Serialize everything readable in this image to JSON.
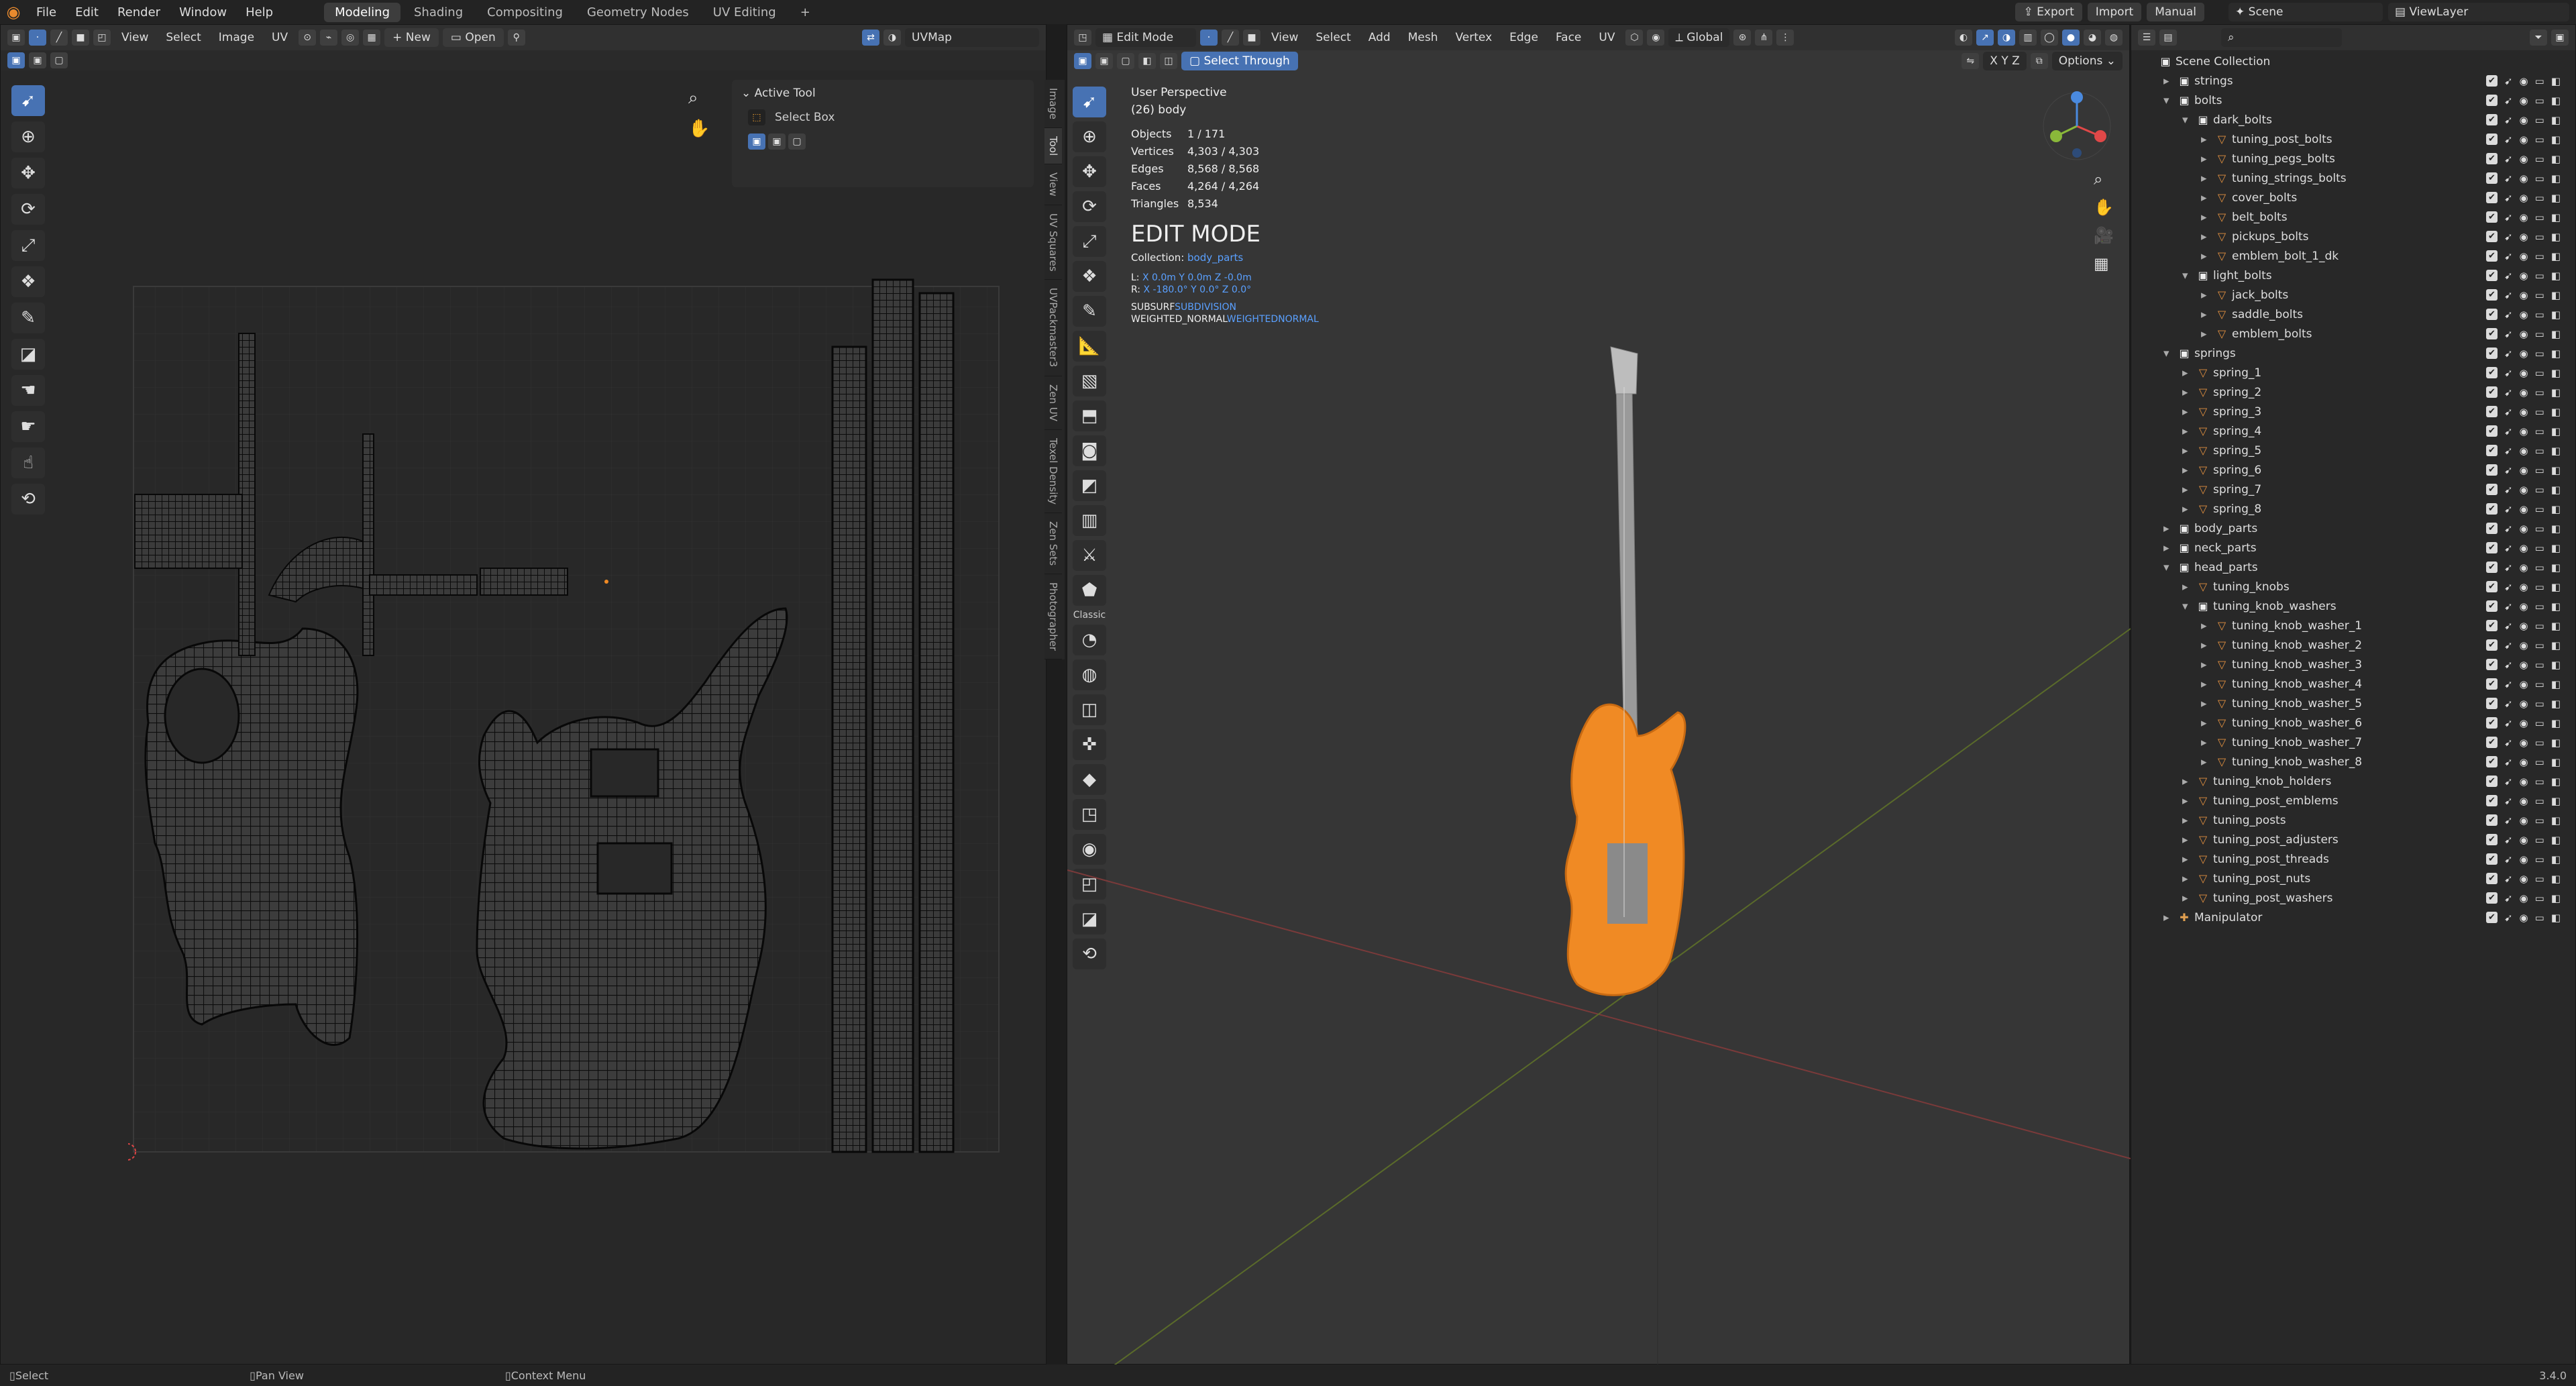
{
  "menu": {
    "items": [
      "File",
      "Edit",
      "Render",
      "Window",
      "Help"
    ]
  },
  "workspaces": {
    "tabs": [
      "Modeling",
      "Shading",
      "Compositing",
      "Geometry Nodes",
      "UV Editing"
    ],
    "active": "Modeling",
    "add": "+"
  },
  "topright": {
    "export": "Export",
    "import": "Import",
    "manual": "Manual",
    "scene": "Scene",
    "view_layer": "ViewLayer"
  },
  "uv_editor": {
    "menus": [
      "View",
      "Select",
      "Image",
      "UV"
    ],
    "new_label": "New",
    "open_label": "Open",
    "uvmap": "UVMap",
    "tabs": [
      "Image",
      "Tool",
      "View",
      "UV Squares",
      "UVPackmaster3",
      "Zen UV",
      "Texel Density",
      "Zen Sets",
      "Photographer"
    ],
    "active_tool_title": "Active Tool",
    "active_tool": "Select Box"
  },
  "viewport": {
    "mode": "Edit Mode",
    "menus": [
      "View",
      "Select",
      "Add",
      "Mesh",
      "Vertex",
      "Edge",
      "Face",
      "UV"
    ],
    "transform": "Global",
    "select_through": "Select Through",
    "options": "Options",
    "xyz": "X Y Z",
    "classic": "Classic",
    "perspective": "User Perspective",
    "object_name": "(26) body",
    "stats": [
      {
        "label": "Objects",
        "value": "1 / 171"
      },
      {
        "label": "Vertices",
        "value": "4,303 / 4,303"
      },
      {
        "label": "Edges",
        "value": "8,568 / 8,568"
      },
      {
        "label": "Faces",
        "value": "4,264 / 4,264"
      },
      {
        "label": "Triangles",
        "value": "8,534"
      }
    ],
    "edit_mode_title": "EDIT MODE",
    "collection_label": "Collection:",
    "collection_value": "body_parts",
    "loc_label": "L:",
    "loc_values": "X 0.0m  Y 0.0m  Z -0.0m",
    "rot_label": "R:",
    "rot_values": "X -180.0°  Y 0.0°  Z 0.0°",
    "mod1_name": "SUBSURF",
    "mod1_value": "SUBDIVISION",
    "mod2_name": "WEIGHTED_NORMAL",
    "mod2_value": "WEIGHTEDNORMAL"
  },
  "outliner": {
    "rows": [
      {
        "name": "Scene Collection",
        "depth": 0,
        "type": "scene"
      },
      {
        "name": "strings",
        "depth": 1,
        "type": "collection",
        "open": false
      },
      {
        "name": "bolts",
        "depth": 1,
        "type": "collection",
        "open": true
      },
      {
        "name": "dark_bolts",
        "depth": 2,
        "type": "collection",
        "open": true
      },
      {
        "name": "tuning_post_bolts",
        "depth": 3,
        "type": "object"
      },
      {
        "name": "tuning_pegs_bolts",
        "depth": 3,
        "type": "object"
      },
      {
        "name": "tuning_strings_bolts",
        "depth": 3,
        "type": "object"
      },
      {
        "name": "cover_bolts",
        "depth": 3,
        "type": "object"
      },
      {
        "name": "belt_bolts",
        "depth": 3,
        "type": "object"
      },
      {
        "name": "pickups_bolts",
        "depth": 3,
        "type": "object"
      },
      {
        "name": "emblem_bolt_1_dk",
        "depth": 3,
        "type": "object"
      },
      {
        "name": "light_bolts",
        "depth": 2,
        "type": "collection",
        "open": true
      },
      {
        "name": "jack_bolts",
        "depth": 3,
        "type": "object"
      },
      {
        "name": "saddle_bolts",
        "depth": 3,
        "type": "object"
      },
      {
        "name": "emblem_bolts",
        "depth": 3,
        "type": "object"
      },
      {
        "name": "springs",
        "depth": 1,
        "type": "collection",
        "open": true
      },
      {
        "name": "spring_1",
        "depth": 2,
        "type": "object"
      },
      {
        "name": "spring_2",
        "depth": 2,
        "type": "object"
      },
      {
        "name": "spring_3",
        "depth": 2,
        "type": "object"
      },
      {
        "name": "spring_4",
        "depth": 2,
        "type": "object"
      },
      {
        "name": "spring_5",
        "depth": 2,
        "type": "object"
      },
      {
        "name": "spring_6",
        "depth": 2,
        "type": "object"
      },
      {
        "name": "spring_7",
        "depth": 2,
        "type": "object"
      },
      {
        "name": "spring_8",
        "depth": 2,
        "type": "object"
      },
      {
        "name": "body_parts",
        "depth": 1,
        "type": "collection",
        "open": false
      },
      {
        "name": "neck_parts",
        "depth": 1,
        "type": "collection",
        "open": false
      },
      {
        "name": "head_parts",
        "depth": 1,
        "type": "collection",
        "open": true
      },
      {
        "name": "tuning_knobs",
        "depth": 2,
        "type": "object"
      },
      {
        "name": "tuning_knob_washers",
        "depth": 2,
        "type": "collection",
        "open": true
      },
      {
        "name": "tuning_knob_washer_1",
        "depth": 3,
        "type": "object"
      },
      {
        "name": "tuning_knob_washer_2",
        "depth": 3,
        "type": "object"
      },
      {
        "name": "tuning_knob_washer_3",
        "depth": 3,
        "type": "object"
      },
      {
        "name": "tuning_knob_washer_4",
        "depth": 3,
        "type": "object"
      },
      {
        "name": "tuning_knob_washer_5",
        "depth": 3,
        "type": "object"
      },
      {
        "name": "tuning_knob_washer_6",
        "depth": 3,
        "type": "object"
      },
      {
        "name": "tuning_knob_washer_7",
        "depth": 3,
        "type": "object"
      },
      {
        "name": "tuning_knob_washer_8",
        "depth": 3,
        "type": "object"
      },
      {
        "name": "tuning_knob_holders",
        "depth": 2,
        "type": "object"
      },
      {
        "name": "tuning_post_emblems",
        "depth": 2,
        "type": "object"
      },
      {
        "name": "tuning_posts",
        "depth": 2,
        "type": "object"
      },
      {
        "name": "tuning_post_adjusters",
        "depth": 2,
        "type": "object"
      },
      {
        "name": "tuning_post_threads",
        "depth": 2,
        "type": "object"
      },
      {
        "name": "tuning_post_nuts",
        "depth": 2,
        "type": "object"
      },
      {
        "name": "tuning_post_washers",
        "depth": 2,
        "type": "object"
      },
      {
        "name": "Manipulator",
        "depth": 1,
        "type": "armature"
      }
    ]
  },
  "statusbar": {
    "select": "Select",
    "pan": "Pan View",
    "context": "Context Menu",
    "version": "3.4.0"
  },
  "colors": {
    "accent": "#4772b3",
    "selection": "#f08a24",
    "grid": "#2f2f2f"
  }
}
